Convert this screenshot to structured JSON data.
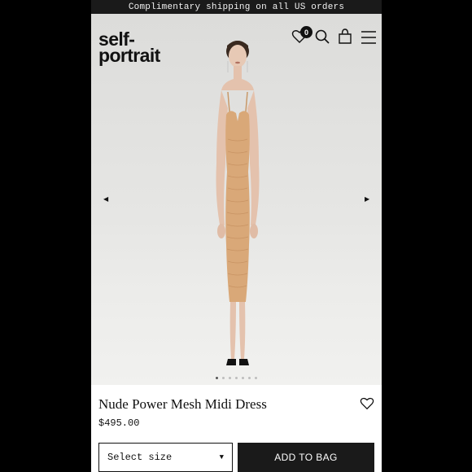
{
  "promo": {
    "text": "Complimentary shipping on all US orders"
  },
  "brand": {
    "line1": "self-",
    "line2": "portrait"
  },
  "header": {
    "wishlist_count": "0"
  },
  "product": {
    "title": "Nude Power Mesh Midi Dress",
    "price": "$495.00",
    "size_placeholder": "Select size",
    "add_to_bag_label": "ADD TO BAG"
  },
  "carousel": {
    "prev_glyph": "◀",
    "next_glyph": "▶",
    "slide_count": 7,
    "active_slide": 1
  },
  "colors": {
    "dress": "#d9a878",
    "background": "#000000",
    "button": "#1a1a1a"
  },
  "icons": [
    "heart-icon",
    "search-icon",
    "bag-icon",
    "menu-icon",
    "chevron-left-icon",
    "chevron-right-icon",
    "caret-down-icon"
  ]
}
